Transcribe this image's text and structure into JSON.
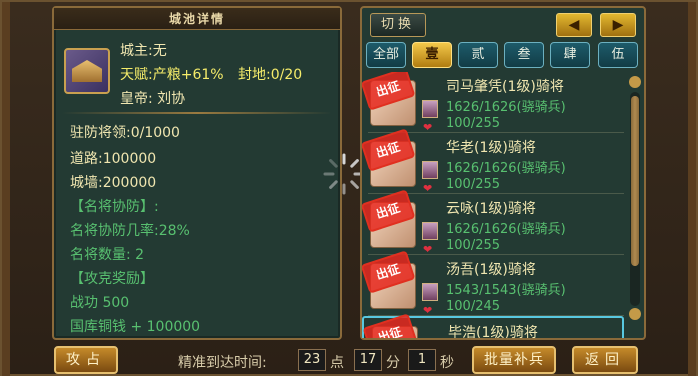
{
  "left": {
    "title": "城池详情",
    "lord": "城主:无",
    "talent": "天赋:产粮+61%",
    "fief": "封地:0/20",
    "emperor": "皇帝: 刘协",
    "garrison": "驻防将领:0/1000",
    "road": "道路:100000",
    "wall": "城墙:200000",
    "famous_defense_header": "【名将协防】:",
    "famous_defense_rate": "名将协防几率:28%",
    "famous_count": "名将数量: 2",
    "reward_header": "【攻克奖励】",
    "merit": "战功 500",
    "treasury": "国库铜钱 + 100000"
  },
  "right": {
    "switch_label": "切换",
    "prev_icon": "left-arrow",
    "next_icon": "right-arrow",
    "tabs": [
      {
        "label": "全部",
        "active": false
      },
      {
        "label": "壹",
        "active": true
      },
      {
        "label": "贰",
        "active": false
      },
      {
        "label": "叁",
        "active": false
      },
      {
        "label": "肆",
        "active": false
      },
      {
        "label": "伍",
        "active": false
      }
    ],
    "stamp_label": "出征",
    "generals": [
      {
        "name": "司马肇凭(1级)骑将",
        "troops": "1626/1626(骁骑兵)",
        "energy": "100/255"
      },
      {
        "name": "华老(1级)骑将",
        "troops": "1626/1626(骁骑兵)",
        "energy": "100/255"
      },
      {
        "name": "云咏(1级)骑将",
        "troops": "1626/1626(骁骑兵)",
        "energy": "100/255"
      },
      {
        "name": "汤吾(1级)骑将",
        "troops": "1543/1543(骁骑兵)",
        "energy": "100/245"
      },
      {
        "name": "毕浩(1级)骑将",
        "troops": "",
        "energy": ""
      }
    ]
  },
  "bottom": {
    "attack_label": "攻占",
    "arrival_label": "精准到达时间:",
    "hour": "23",
    "hour_unit": "点",
    "minute": "17",
    "minute_unit": "分",
    "second": "1",
    "second_unit": "秒",
    "batch_label": "批量补兵",
    "back_label": "返回"
  },
  "colors": {
    "panel_bg": "#233a33",
    "gold_text": "#f5ec6a",
    "green_text": "#58c070",
    "frame_border": "#8a6a3a",
    "active_tab": "#f3c84a"
  }
}
